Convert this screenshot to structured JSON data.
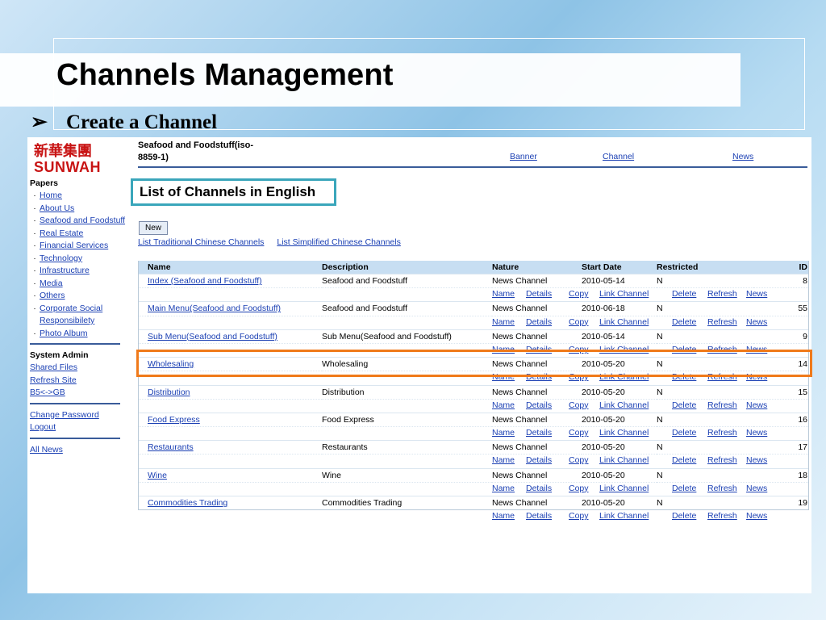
{
  "slide": {
    "title": "Channels Management",
    "bullet_glyph": "➢",
    "bullet_text": "Create a Channel"
  },
  "logo": {
    "chinese": "新華集團",
    "english": "SUNWAH"
  },
  "sidebar": {
    "papers_heading": "Papers",
    "papers": [
      "Home",
      "About Us",
      "Seafood and Foodstuff",
      "Real Estate",
      "Financial Services",
      "Technology",
      "Infrastructure",
      "Media",
      "Others",
      "Corporate Social Responsibilety",
      "Photo Album"
    ],
    "admin_heading": "System Admin",
    "admin_links": [
      "Shared Files",
      "Refresh Site",
      "B5<->GB"
    ],
    "account_links": [
      "Change Password",
      "Logout"
    ],
    "all_news": "All News"
  },
  "header": {
    "site_title": "Seafood and Foodstuff(iso-8859-1)",
    "links": [
      "Banner",
      "Channel",
      "News"
    ]
  },
  "page_heading": "List of Channels in English",
  "new_button": "New",
  "list_links": [
    "List Traditional Chinese Channels",
    "List Simplified Chinese Channels"
  ],
  "table": {
    "columns": [
      "Name",
      "Description",
      "Nature",
      "Start Date",
      "Restricted",
      "ID"
    ],
    "action_labels": [
      "Name",
      "Details",
      "Copy",
      "Link Channel",
      "Delete",
      "Refresh",
      "News"
    ],
    "rows": [
      {
        "name": "Index (Seafood and Foodstuff)",
        "description": "Seafood and Foodstuff",
        "nature": "News Channel",
        "start_date": "2010-05-14",
        "restricted": "N",
        "id": "8"
      },
      {
        "name": "Main Menu(Seafood and Foodstuff)",
        "description": "Seafood and Foodstuff",
        "nature": "News Channel",
        "start_date": "2010-06-18",
        "restricted": "N",
        "id": "55"
      },
      {
        "name": "Sub Menu(Seafood and Foodstuff)",
        "description": "Sub Menu(Seafood and Foodstuff)",
        "nature": "News Channel",
        "start_date": "2010-05-14",
        "restricted": "N",
        "id": "9"
      },
      {
        "name": "Wholesaling",
        "description": "Wholesaling",
        "nature": "News Channel",
        "start_date": "2010-05-20",
        "restricted": "N",
        "id": "14"
      },
      {
        "name": "Distribution",
        "description": "Distribution",
        "nature": "News Channel",
        "start_date": "2010-05-20",
        "restricted": "N",
        "id": "15"
      },
      {
        "name": "Food Express",
        "description": "Food Express",
        "nature": "News Channel",
        "start_date": "2010-05-20",
        "restricted": "N",
        "id": "16"
      },
      {
        "name": "Restaurants",
        "description": "Restaurants",
        "nature": "News Channel",
        "start_date": "2010-05-20",
        "restricted": "N",
        "id": "17"
      },
      {
        "name": "Wine",
        "description": "Wine",
        "nature": "News Channel",
        "start_date": "2010-05-20",
        "restricted": "N",
        "id": "18"
      },
      {
        "name": "Commodities Trading",
        "description": "Commodities Trading",
        "nature": "News Channel",
        "start_date": "2010-05-20",
        "restricted": "N",
        "id": "19"
      }
    ]
  },
  "colors": {
    "highlight_row": "#f07a1a",
    "heading_box": "#3aa6bb",
    "link": "#1a3fb3",
    "logo": "#c81414"
  }
}
